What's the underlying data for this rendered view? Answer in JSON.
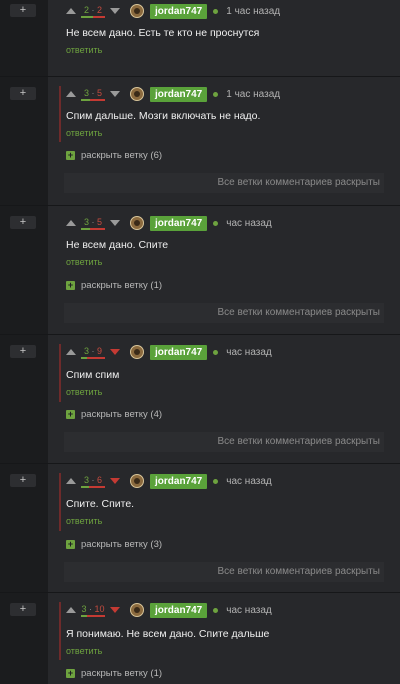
{
  "collapse_symbol": "+",
  "labels": {
    "reply": "ответить",
    "all_open": "Все ветки комментариев раскрыты"
  },
  "colors": {
    "username_bg": "#5aa23a",
    "reply": "#6ea33f",
    "minus": "#c43a33",
    "thread_line": "#6e2b2b"
  },
  "comments": [
    {
      "score_plus": "2",
      "score_minus": "2",
      "author": "jordan747",
      "time": "1 час назад",
      "text": "Не всем дано. Есть те кто не проснутся",
      "downvoted": false,
      "ratio_plus": 0.5
    },
    {
      "score_plus": "3",
      "score_minus": "5",
      "author": "jordan747",
      "time": "1 час назад",
      "text": "Спим дальше. Мозги включать не надо.",
      "expand": "раскрыть ветку (6)",
      "downvoted": false,
      "ratio_plus": 0.375
    },
    {
      "score_plus": "3",
      "score_minus": "5",
      "author": "jordan747",
      "time": "час назад",
      "text": "Не всем дано. Спите",
      "expand": "раскрыть ветку (1)",
      "downvoted": false,
      "ratio_plus": 0.375
    },
    {
      "score_plus": "3",
      "score_minus": "9",
      "author": "jordan747",
      "time": "час назад",
      "text": "Спим спим",
      "expand": "раскрыть ветку (4)",
      "downvoted": true,
      "ratio_plus": 0.25
    },
    {
      "score_plus": "3",
      "score_minus": "6",
      "author": "jordan747",
      "time": "час назад",
      "text": "Спите. Спите.",
      "expand": "раскрыть ветку (3)",
      "downvoted": true,
      "ratio_plus": 0.333
    },
    {
      "score_plus": "3",
      "score_minus": "10",
      "author": "jordan747",
      "time": "час назад",
      "text": "Я понимаю. Не всем дано. Спите дальше",
      "expand": "раскрыть ветку (1)",
      "downvoted": true,
      "ratio_plus": 0.23
    }
  ]
}
